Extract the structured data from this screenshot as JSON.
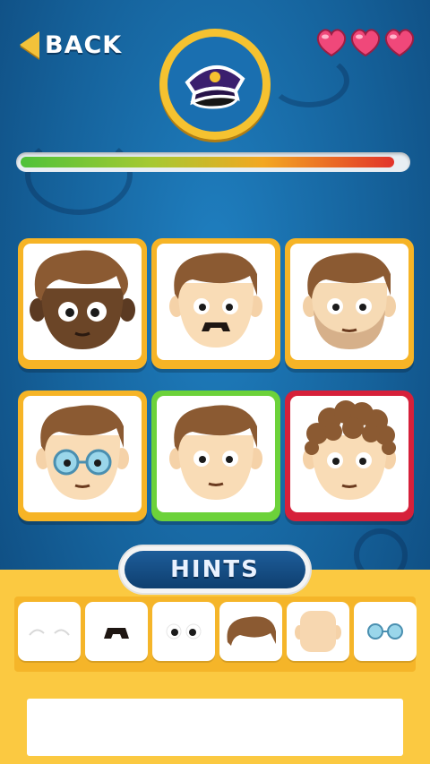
{
  "header": {
    "back_label": "BACK",
    "lives": 3,
    "target_item_icon": "police-cap-icon"
  },
  "timer": {
    "progress": 0.97
  },
  "cards": [
    {
      "name": "card-dark-skin-face",
      "state": "default"
    },
    {
      "name": "card-mustache-face",
      "state": "default"
    },
    {
      "name": "card-beard-face",
      "state": "default"
    },
    {
      "name": "card-glasses-face",
      "state": "default"
    },
    {
      "name": "card-plain-face",
      "state": "correct"
    },
    {
      "name": "card-curly-hair-face",
      "state": "wrong"
    }
  ],
  "hints": {
    "title": "HINTS",
    "items": [
      {
        "icon": "eyebrows-icon"
      },
      {
        "icon": "mustache-icon"
      },
      {
        "icon": "eyes-icon"
      },
      {
        "icon": "hair-icon"
      },
      {
        "icon": "face-shape-icon"
      },
      {
        "icon": "glasses-icon"
      }
    ]
  },
  "colors": {
    "accent_yellow": "#f6b426",
    "correct_green": "#6cd23a",
    "wrong_red": "#d6203a",
    "background_blue": "#1a6fb0"
  }
}
